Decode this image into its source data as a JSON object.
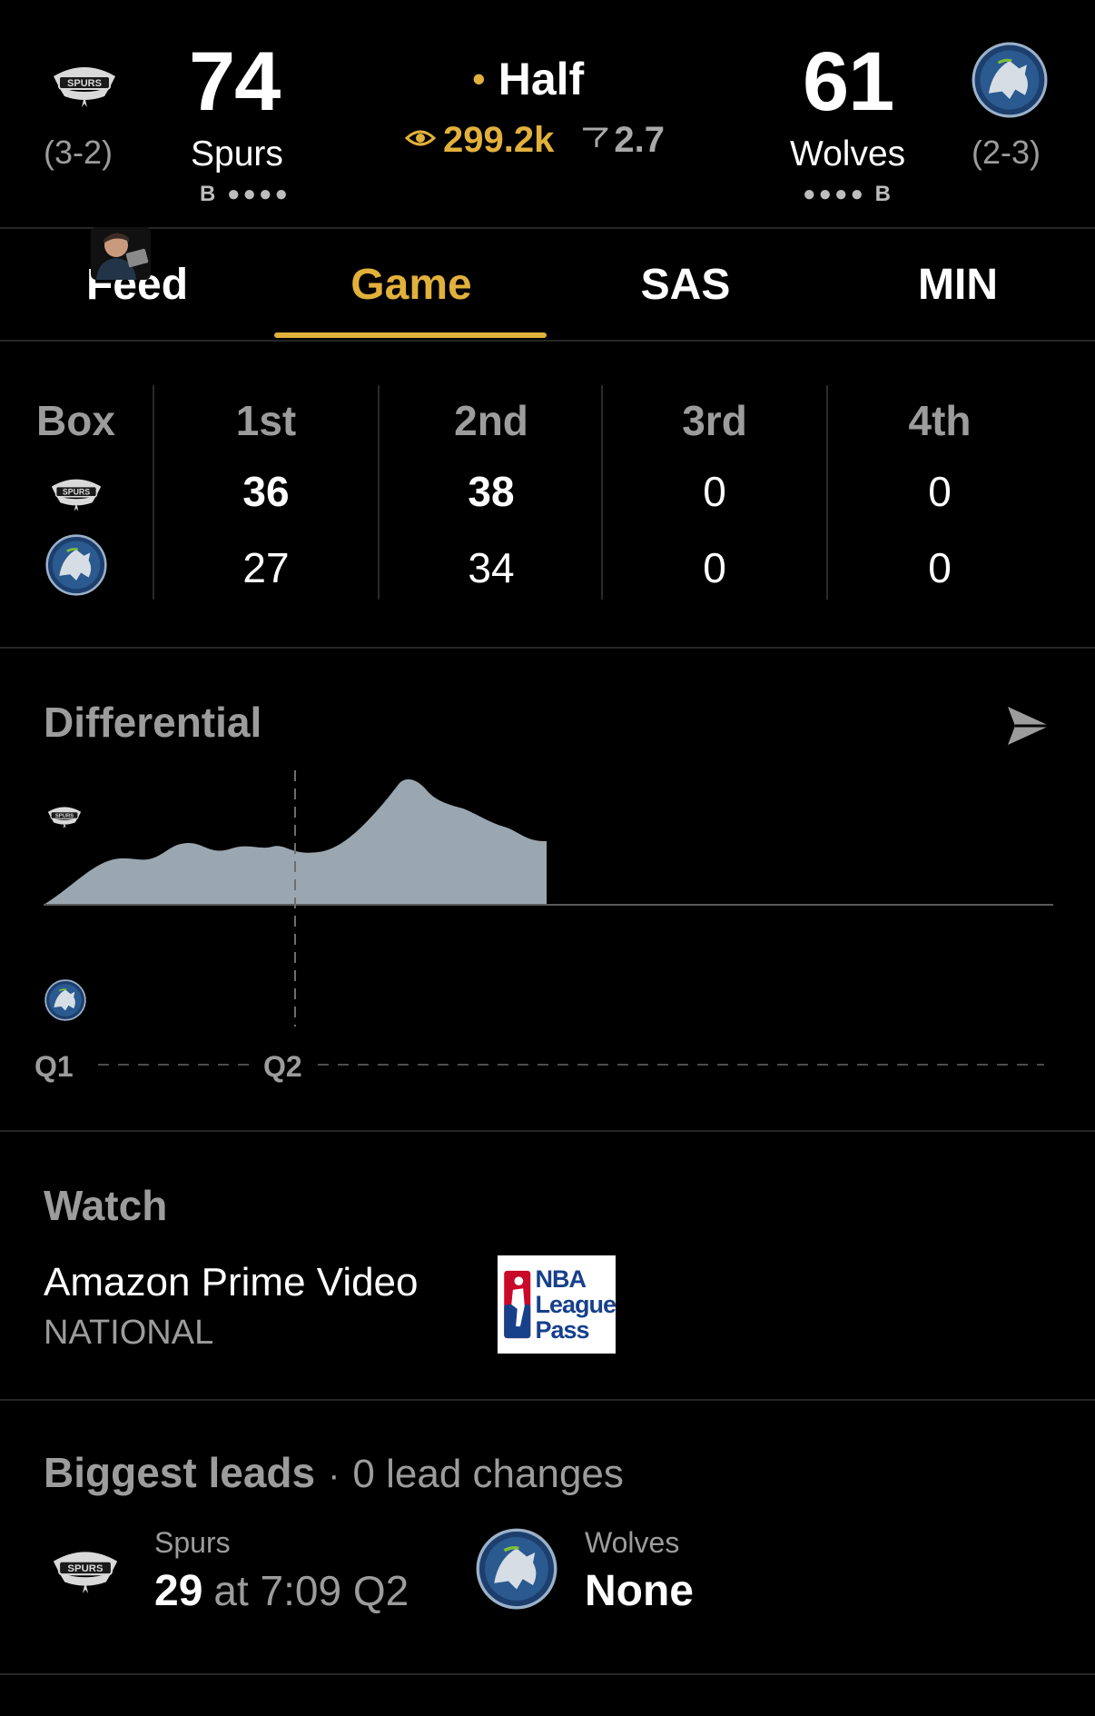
{
  "header": {
    "home": {
      "name": "Spurs",
      "score": "74",
      "record": "(3-2)",
      "timeouts": "B ●●●●",
      "logo": "spurs-logo"
    },
    "away": {
      "name": "Wolves",
      "score": "61",
      "record": "(2-3)",
      "timeouts": "●●●● B",
      "logo": "wolves-logo"
    },
    "status": "Half",
    "status_dot": "•",
    "viewers": "299.2k",
    "rating": "2.7"
  },
  "tabs": [
    {
      "label": "Feed",
      "active": false
    },
    {
      "label": "Game",
      "active": true
    },
    {
      "label": "SAS",
      "active": false
    },
    {
      "label": "MIN",
      "active": false
    }
  ],
  "box": {
    "header": [
      "Box",
      "1st",
      "2nd",
      "3rd",
      "4th"
    ],
    "rows": [
      {
        "team": "Spurs",
        "values": [
          "36",
          "38",
          "0",
          "0"
        ]
      },
      {
        "team": "Wolves",
        "values": [
          "27",
          "34",
          "0",
          "0"
        ]
      }
    ]
  },
  "differential": {
    "title": "Differential",
    "quarter_labels": [
      "Q1",
      "Q2"
    ]
  },
  "watch": {
    "title": "Watch",
    "provider": "Amazon Prime Video",
    "scope": "NATIONAL",
    "league_pass": [
      "NBA",
      "League",
      "Pass"
    ]
  },
  "biggest_leads": {
    "title": "Biggest leads",
    "separator": "·",
    "lead_changes": "0 lead changes",
    "home": {
      "team": "Spurs",
      "value": "29",
      "detail": "at 7:09 Q2"
    },
    "away": {
      "team": "Wolves",
      "value": "None"
    }
  },
  "colors": {
    "accent": "#e2b13c",
    "background": "#000000",
    "chart_fill": "#9aa7b1",
    "wolves_blue": "#1d3f6e"
  }
}
